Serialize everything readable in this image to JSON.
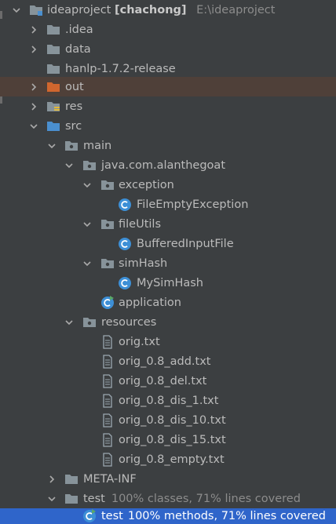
{
  "project": {
    "name": "ideaproject",
    "module_tag": "[chachong]",
    "path": "E:\\ideaproject"
  },
  "tree": {
    "idea": ".idea",
    "data": "data",
    "hanlp": "hanlp-1.7.2-release",
    "out": "out",
    "res": "res",
    "src": "src",
    "main": "main",
    "package": "java.com.alanthegoat",
    "exception": "exception",
    "file_empty_exception": "FileEmptyException",
    "file_utils": "fileUtils",
    "buffered_input_file": "BufferedInputFile",
    "sim_hash": "simHash",
    "my_sim_hash": "MySimHash",
    "application": "application",
    "resources": "resources",
    "files": [
      "orig.txt",
      "orig_0.8_add.txt",
      "orig_0.8_del.txt",
      "orig_0.8_dis_1.txt",
      "orig_0.8_dis_10.txt",
      "orig_0.8_dis_15.txt",
      "orig_0.8_empty.txt"
    ],
    "meta_inf": "META-INF",
    "test_dir": "test",
    "test_dir_coverage": "100% classes, 71% lines covered",
    "test_class": "test",
    "test_class_coverage": "100% methods, 71% lines covered"
  },
  "icons": {
    "folder": "folder-icon",
    "source_folder": "source-folder-icon",
    "package": "package-icon",
    "class": "class-icon",
    "text_file": "text-file-icon",
    "expand": "chevron-down-icon",
    "collapse": "chevron-right-icon"
  },
  "colors": {
    "background": "#3c3f41",
    "text": "#bbbbbb",
    "hint": "#8c8c8c",
    "selection": "#2f65ca",
    "excluded_row": "#4f4039",
    "excluded_folder": "#d0662e",
    "folder": "#87939a",
    "source_folder": "#4a8fcf",
    "class_badge": "#3d8fd6"
  }
}
